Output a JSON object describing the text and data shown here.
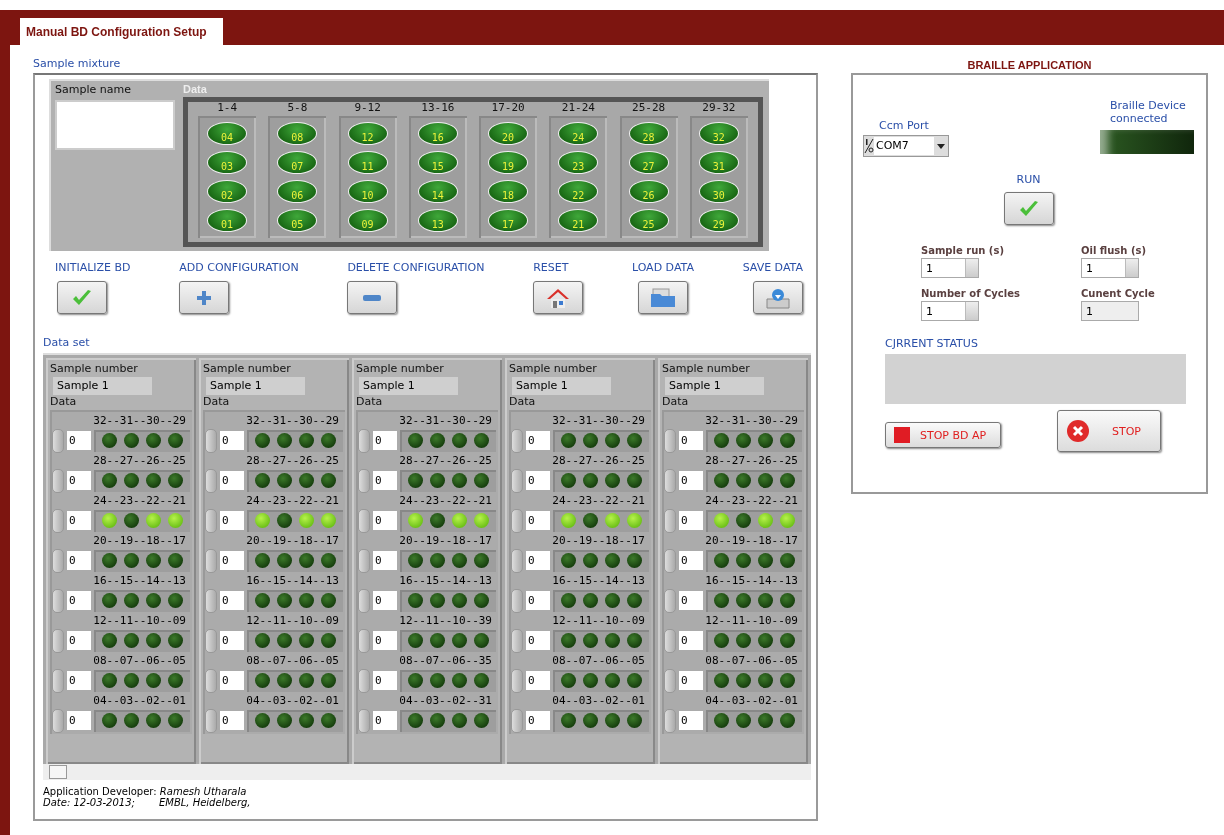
{
  "tab": {
    "label": "Manual BD Configuration Setup",
    "selected": true
  },
  "sample_mixture": {
    "title": "Sample mixture",
    "sample_name_label": "Sample name",
    "data_label": "Data",
    "groups": [
      {
        "label": "1-4",
        "wells": [
          "04",
          "03",
          "02",
          "01"
        ]
      },
      {
        "label": "5-8",
        "wells": [
          "08",
          "07",
          "06",
          "05"
        ]
      },
      {
        "label": "9-12",
        "wells": [
          "12",
          "11",
          "10",
          "09"
        ]
      },
      {
        "label": "13-16",
        "wells": [
          "16",
          "15",
          "14",
          "13"
        ]
      },
      {
        "label": "17-20",
        "wells": [
          "20",
          "19",
          "18",
          "17"
        ]
      },
      {
        "label": "21-24",
        "wells": [
          "24",
          "23",
          "22",
          "21"
        ]
      },
      {
        "label": "25-28",
        "wells": [
          "28",
          "27",
          "26",
          "25"
        ]
      },
      {
        "label": "29-32",
        "wells": [
          "32",
          "31",
          "30",
          "29"
        ]
      }
    ],
    "buttons": [
      {
        "label": "INITIALIZE BD",
        "kind": "check"
      },
      {
        "label": "ADD CONFIGURATION",
        "kind": "plus"
      },
      {
        "label": "DELETE CONFIGURATION",
        "kind": "minus"
      },
      {
        "label": "RESET",
        "kind": "home"
      },
      {
        "label": "LOAD DATA",
        "kind": "load"
      },
      {
        "label": "SAVE DATA",
        "kind": "save"
      }
    ]
  },
  "data_set": {
    "title": "Data set",
    "panels": [
      {
        "sample_label": "Sample number",
        "sample_value": "Sample 1",
        "data_label": "Data",
        "rows": [
          {
            "label": "32--31--30--29",
            "value": "0",
            "leds": [
              false,
              false,
              false,
              false
            ]
          },
          {
            "label": "28--27--26--25",
            "value": "0",
            "leds": [
              false,
              false,
              false,
              false
            ]
          },
          {
            "label": "24--23--22--21",
            "value": "0",
            "leds": [
              true,
              false,
              true,
              true
            ]
          },
          {
            "label": "20--19--18--17",
            "value": "0",
            "leds": [
              false,
              false,
              false,
              false
            ]
          },
          {
            "label": "16--15--14--13",
            "value": "0",
            "leds": [
              false,
              false,
              false,
              false
            ]
          },
          {
            "label": "12--11--10--09",
            "value": "0",
            "leds": [
              false,
              false,
              false,
              false
            ]
          },
          {
            "label": "08--07--06--05",
            "value": "0",
            "leds": [
              false,
              false,
              false,
              false
            ]
          },
          {
            "label": "04--03--02--01",
            "value": "0",
            "leds": [
              false,
              false,
              false,
              false
            ]
          }
        ]
      },
      {
        "sample_label": "Sample number",
        "sample_value": "Sample 1",
        "data_label": "Data",
        "rows": [
          {
            "label": "32--31--30--29",
            "value": "0",
            "leds": [
              false,
              false,
              false,
              false
            ]
          },
          {
            "label": "28--27--26--25",
            "value": "0",
            "leds": [
              false,
              false,
              false,
              false
            ]
          },
          {
            "label": "24--23--22--21",
            "value": "0",
            "leds": [
              true,
              false,
              true,
              true
            ]
          },
          {
            "label": "20--19--18--17",
            "value": "0",
            "leds": [
              false,
              false,
              false,
              false
            ]
          },
          {
            "label": "16--15--14--13",
            "value": "0",
            "leds": [
              false,
              false,
              false,
              false
            ]
          },
          {
            "label": "12--11--10--09",
            "value": "0",
            "leds": [
              false,
              false,
              false,
              false
            ]
          },
          {
            "label": "08--07--06--05",
            "value": "0",
            "leds": [
              false,
              false,
              false,
              false
            ]
          },
          {
            "label": "04--03--02--01",
            "value": "0",
            "leds": [
              false,
              false,
              false,
              false
            ]
          }
        ]
      },
      {
        "sample_label": "Sample number",
        "sample_value": "Sample 1",
        "data_label": "Data",
        "rows": [
          {
            "label": "32--31--30--29",
            "value": "0",
            "leds": [
              false,
              false,
              false,
              false
            ]
          },
          {
            "label": "28--27--26--25",
            "value": "0",
            "leds": [
              false,
              false,
              false,
              false
            ]
          },
          {
            "label": "24--23--22--21",
            "value": "0",
            "leds": [
              true,
              false,
              true,
              true
            ]
          },
          {
            "label": "20--19--18--17",
            "value": "0",
            "leds": [
              false,
              false,
              false,
              false
            ]
          },
          {
            "label": "16--15--14--13",
            "value": "0",
            "leds": [
              false,
              false,
              false,
              false
            ]
          },
          {
            "label": "12--11--10--39",
            "value": "0",
            "leds": [
              false,
              false,
              false,
              false
            ]
          },
          {
            "label": "08--07--06--35",
            "value": "0",
            "leds": [
              false,
              false,
              false,
              false
            ]
          },
          {
            "label": "04--03--02--31",
            "value": "0",
            "leds": [
              false,
              false,
              false,
              false
            ]
          }
        ]
      },
      {
        "sample_label": "Sample number",
        "sample_value": "Sample 1",
        "data_label": "Data",
        "rows": [
          {
            "label": "32--31--30--29",
            "value": "0",
            "leds": [
              false,
              false,
              false,
              false
            ]
          },
          {
            "label": "28--27--26--25",
            "value": "0",
            "leds": [
              false,
              false,
              false,
              false
            ]
          },
          {
            "label": "24--23--22--21",
            "value": "0",
            "leds": [
              true,
              false,
              true,
              true
            ]
          },
          {
            "label": "20--19--18--17",
            "value": "0",
            "leds": [
              false,
              false,
              false,
              false
            ]
          },
          {
            "label": "16--15--14--13",
            "value": "0",
            "leds": [
              false,
              false,
              false,
              false
            ]
          },
          {
            "label": "12--11--10--09",
            "value": "0",
            "leds": [
              false,
              false,
              false,
              false
            ]
          },
          {
            "label": "08--07--06--05",
            "value": "0",
            "leds": [
              false,
              false,
              false,
              false
            ]
          },
          {
            "label": "04--03--02--01",
            "value": "0",
            "leds": [
              false,
              false,
              false,
              false
            ]
          }
        ]
      },
      {
        "sample_label": "Sample number",
        "sample_value": "Sample 1",
        "data_label": "Data",
        "rows": [
          {
            "label": "32--31--30--29",
            "value": "0",
            "leds": [
              false,
              false,
              false,
              false
            ]
          },
          {
            "label": "28--27--26--25",
            "value": "0",
            "leds": [
              false,
              false,
              false,
              false
            ]
          },
          {
            "label": "24--23--22--21",
            "value": "0",
            "leds": [
              true,
              false,
              true,
              true
            ]
          },
          {
            "label": "20--19--18--17",
            "value": "0",
            "leds": [
              false,
              false,
              false,
              false
            ]
          },
          {
            "label": "16--15--14--13",
            "value": "0",
            "leds": [
              false,
              false,
              false,
              false
            ]
          },
          {
            "label": "12--11--10--09",
            "value": "0",
            "leds": [
              false,
              false,
              false,
              false
            ]
          },
          {
            "label": "08--07--06--05",
            "value": "0",
            "leds": [
              false,
              false,
              false,
              false
            ]
          },
          {
            "label": "04--03--02--01",
            "value": "0",
            "leds": [
              false,
              false,
              false,
              false
            ]
          }
        ]
      }
    ]
  },
  "footer": {
    "developer": "Application Developer: *Ramesh Utharala*",
    "date": "Date: 12-03-2013;",
    "location": "EMBL, Heidelberg,"
  },
  "braille": {
    "title": "BRAILLE APPLICATION",
    "com_port": {
      "label": "Ccm Port",
      "value": "COM7"
    },
    "device": {
      "label": "Braille Device connected",
      "on": false
    },
    "run_label": "RUN",
    "fields": [
      {
        "label": "Sample run (s)",
        "value": "1",
        "kind": "spin"
      },
      {
        "label": "Oil flush (s)",
        "value": "1",
        "kind": "spin"
      },
      {
        "label": "Number of Cycles",
        "value": "1",
        "kind": "spin"
      },
      {
        "label": "Cunent Cycle",
        "value": "1",
        "kind": "readout"
      }
    ],
    "status_label": "CJRRENT STATUS",
    "buttons": [
      {
        "label": "STOP BD AP",
        "kind": "square"
      },
      {
        "label": "STOP",
        "kind": "cross"
      }
    ]
  }
}
